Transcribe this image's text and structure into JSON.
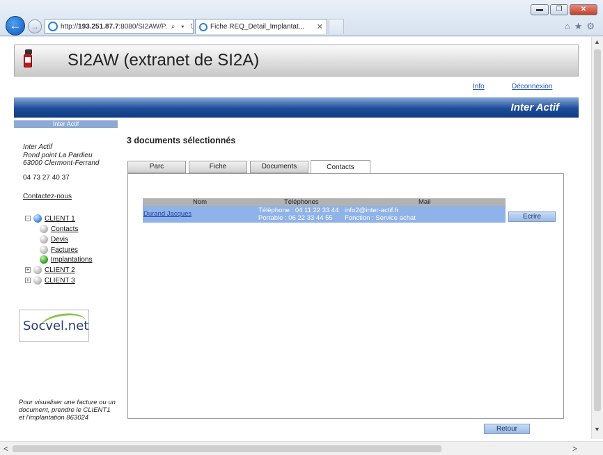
{
  "browser": {
    "address": {
      "prefix": "http://",
      "host": "193.251.87.7",
      "rest": ":8080/SI2AW/P.",
      "tools": "⌕ ▾ ↻"
    },
    "tab_title": "Fiche REQ_Detail_Implantat...",
    "tab_close": "✕",
    "window_buttons": {
      "minimize": "▬",
      "restore": "❐",
      "close": "✕"
    },
    "nav": {
      "back": "←",
      "forward": "→"
    },
    "right_icons": {
      "home": "⌂",
      "favorites": "★",
      "settings": "⚙"
    }
  },
  "header": {
    "title": "SI2AW (extranet de SI2A)",
    "links": {
      "info": "Info",
      "logout": "Déconnexion"
    },
    "bar_text": "Inter Actif"
  },
  "sidebar": {
    "head": "Inter Actif",
    "address_lines": [
      "Inter Actif",
      "Rond point La Pardieu",
      "63000 Clermont-Ferrand"
    ],
    "phone": "04 73 27 40 37",
    "contact_link": "Contactez-nous",
    "tree": {
      "client1": {
        "label": "CLIENT 1",
        "expander": "−"
      },
      "children": [
        "Contacts",
        "Devis",
        "Factures",
        "Implantations"
      ],
      "client2": {
        "label": "CLIENT 2",
        "expander": "+"
      },
      "client3": {
        "label": "CLIENT 3",
        "expander": "+"
      }
    },
    "logo_text": "Socvel.net",
    "note": "Pour visualiser une facture ou un document, prendre le CLIENT1 et l'implantation 863024"
  },
  "main": {
    "heading": "3 documents sélectionnés",
    "tabs": [
      "Parc",
      "Fiche",
      "Documents",
      "Contacts"
    ],
    "active_tab": "Contacts",
    "grid": {
      "columns": [
        "Nom",
        "Téléphones",
        "Mail"
      ],
      "rows": [
        {
          "name": "Durand Jacques",
          "tel_line1": "Téléphone : 04 11 22 33 44",
          "tel_line2": "Portable : 06 22 33 44 55",
          "mail_line1": "info2@inter-actif.fr",
          "mail_line2": "Fonction : Service achat"
        }
      ]
    },
    "write_button": "Ecrire",
    "back_button": "Retour"
  },
  "scrollbars": {
    "up": "▲",
    "down": "▼",
    "left": "<",
    "right": ">"
  }
}
